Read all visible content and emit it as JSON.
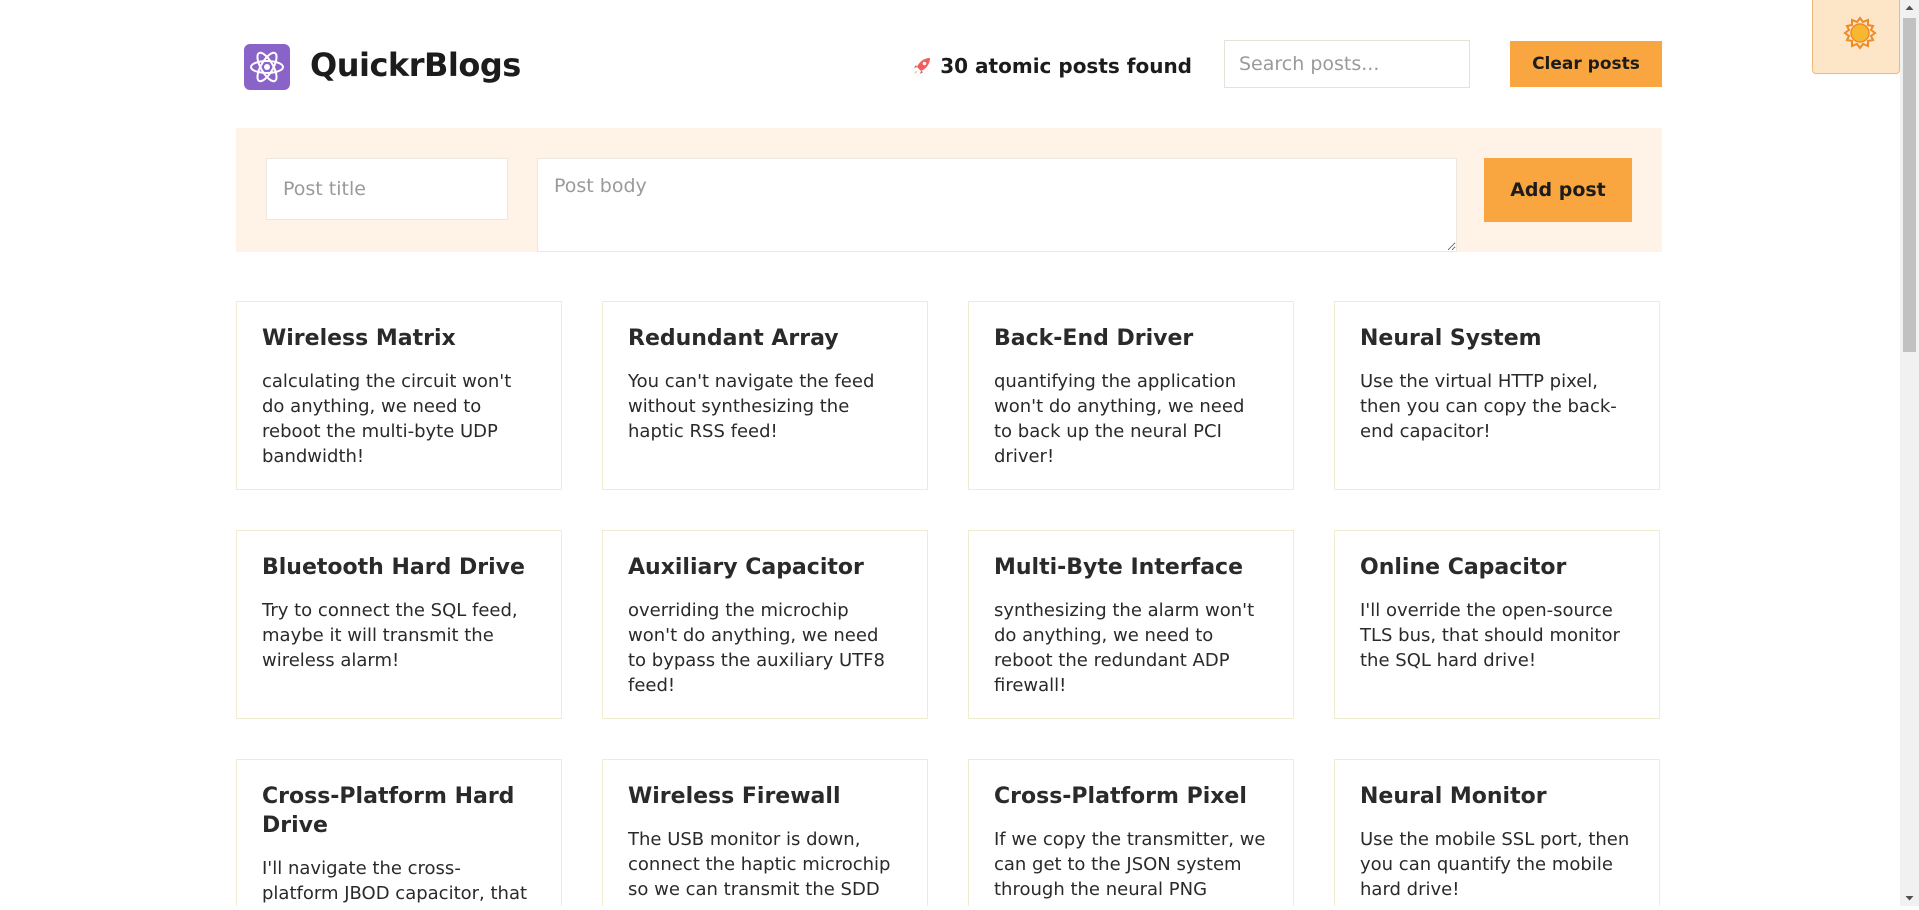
{
  "header": {
    "brand": "QuickrBlogs",
    "logo_icon": "atom-icon",
    "count_icon": "rocket-icon",
    "count_text": "30 atomic posts found",
    "search_placeholder": "Search posts...",
    "clear_label": "Clear posts"
  },
  "form": {
    "title_placeholder": "Post title",
    "body_placeholder": "Post body",
    "add_label": "Add post"
  },
  "theme_toggle": {
    "icon": "sun-icon"
  },
  "colors": {
    "accent": "#f9a640",
    "form_background": "#fef3e6",
    "logo_background": "#8a63c9",
    "sun": "#f7b731"
  },
  "posts": [
    {
      "title": "Wireless Matrix",
      "body": "calculating the circuit won't do anything, we need to reboot the multi-byte UDP bandwidth!"
    },
    {
      "title": "Redundant Array",
      "body": "You can't navigate the feed without synthesizing the haptic RSS feed!"
    },
    {
      "title": "Back-End Driver",
      "body": "quantifying the application won't do anything, we need to back up the neural PCI driver!"
    },
    {
      "title": "Neural System",
      "body": "Use the virtual HTTP pixel, then you can copy the back-end capacitor!"
    },
    {
      "title": "Bluetooth Hard Drive",
      "body": "Try to connect the SQL feed, maybe it will transmit the wireless alarm!"
    },
    {
      "title": "Auxiliary Capacitor",
      "body": "overriding the microchip won't do anything, we need to bypass the auxiliary UTF8 feed!"
    },
    {
      "title": "Multi-Byte Interface",
      "body": "synthesizing the alarm won't do anything, we need to reboot the redundant ADP firewall!"
    },
    {
      "title": "Online Capacitor",
      "body": "I'll override the open-source TLS bus, that should monitor the SQL hard drive!"
    },
    {
      "title": "Cross-Platform Hard Drive",
      "body": "I'll navigate the cross-platform JBOD capacitor, that should"
    },
    {
      "title": "Wireless Firewall",
      "body": "The USB monitor is down, connect the haptic microchip so we can transmit the SDD"
    },
    {
      "title": "Cross-Platform Pixel",
      "body": "If we copy the transmitter, we can get to the JSON system through the neural PNG"
    },
    {
      "title": "Neural Monitor",
      "body": "Use the mobile SSL port, then you can quantify the mobile hard drive!"
    }
  ]
}
